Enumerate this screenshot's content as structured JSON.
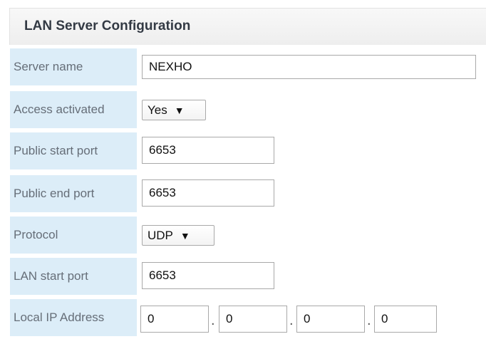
{
  "header": {
    "title": "LAN Server Configuration"
  },
  "rows": {
    "server_name": {
      "label": "Server name",
      "value": "NEXHO"
    },
    "access_activated": {
      "label": "Access activated",
      "value": "Yes"
    },
    "public_start_port": {
      "label": "Public start port",
      "value": "6653"
    },
    "public_end_port": {
      "label": "Public end port",
      "value": "6653"
    },
    "protocol": {
      "label": "Protocol",
      "value": "UDP"
    },
    "lan_start_port": {
      "label": "LAN start port",
      "value": "6653"
    },
    "local_ip": {
      "label": "Local IP Address",
      "octets": [
        "0",
        "0",
        "0",
        "0"
      ],
      "separator": "."
    }
  },
  "icons": {
    "select_arrow": "▼"
  }
}
